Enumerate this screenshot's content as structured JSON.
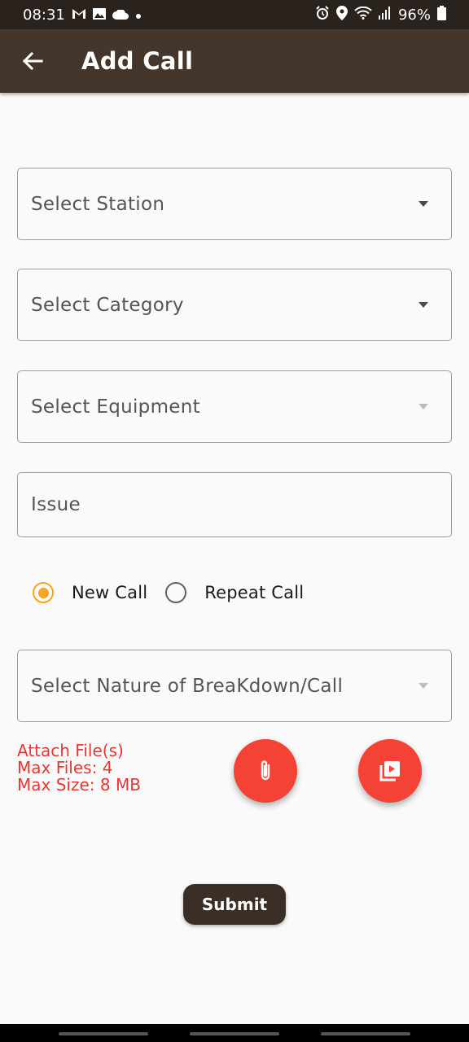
{
  "status_bar": {
    "time": "08:31",
    "battery": "96%",
    "icons_left": [
      "gmail-icon",
      "image-icon",
      "cloud-icon",
      "dot-icon"
    ],
    "icons_right": [
      "alarm-icon",
      "location-icon",
      "wifi-icon",
      "signal-icon",
      "battery-icon"
    ]
  },
  "app_bar": {
    "title": "Add Call",
    "back_icon": "arrow-left-icon",
    "background": "#45362b"
  },
  "form": {
    "station": {
      "label": "Select Station"
    },
    "category": {
      "label": "Select Category"
    },
    "equipment": {
      "label": "Select Equipment"
    },
    "issue": {
      "label": "Issue"
    },
    "call_type": {
      "options": [
        "New Call",
        "Repeat Call"
      ],
      "selected": "New Call",
      "accent": "#f5a623"
    },
    "nature": {
      "label": "Select Nature of BreaKdown/Call"
    }
  },
  "attachments": {
    "title": "Attach File(s)",
    "max_files": "Max Files: 4",
    "max_size": "Max Size: 8 MB",
    "color": "#e53935",
    "buttons": [
      "paperclip-icon",
      "video-library-icon"
    ]
  },
  "submit": {
    "label": "Submit"
  }
}
